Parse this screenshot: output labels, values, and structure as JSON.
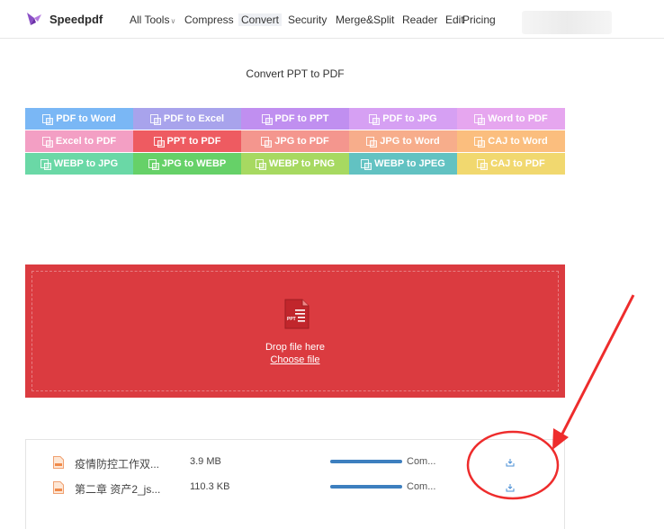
{
  "header": {
    "brand": "Speedpdf",
    "nav": [
      {
        "label": "All Tools"
      },
      {
        "label": "Compress"
      },
      {
        "label": "Convert"
      },
      {
        "label": "Security"
      },
      {
        "label": "Merge&Split"
      },
      {
        "label": "Reader"
      },
      {
        "label": "Edit"
      },
      {
        "label": "Pricing"
      }
    ],
    "active_nav": "Convert"
  },
  "page_title": "Convert PPT to PDF",
  "tools": [
    {
      "label": "PDF to Word",
      "color": "#7ab7f5"
    },
    {
      "label": "PDF to Excel",
      "color": "#a8a3ec"
    },
    {
      "label": "PDF to PPT",
      "color": "#c08ff0"
    },
    {
      "label": "PDF to JPG",
      "color": "#d6a0f3"
    },
    {
      "label": "Word to PDF",
      "color": "#e6a6ef"
    },
    {
      "label": "Excel to PDF",
      "color": "#f39fc4"
    },
    {
      "label": "PPT to PDF",
      "color": "#ee5b61"
    },
    {
      "label": "JPG to PDF",
      "color": "#f4968e"
    },
    {
      "label": "JPG to Word",
      "color": "#f7ad8b"
    },
    {
      "label": "CAJ to Word",
      "color": "#fbbe7e"
    },
    {
      "label": "WEBP to JPG",
      "color": "#6ad8a6"
    },
    {
      "label": "JPG to WEBP",
      "color": "#66d168"
    },
    {
      "label": "WEBP to PNG",
      "color": "#a7d961"
    },
    {
      "label": "WEBP to JPEG",
      "color": "#62c2c2"
    },
    {
      "label": "CAJ to PDF",
      "color": "#f1d86f"
    }
  ],
  "dropzone": {
    "color": "#db3b40",
    "text": "Drop file here",
    "choose_label": "Choose file",
    "file_type_icon": "ppt-file-icon"
  },
  "files": [
    {
      "name": "疫情防控工作双...",
      "size": "3.9 MB",
      "progress": 1.0,
      "status": "Com..."
    },
    {
      "name": "第二章 资产2_js...",
      "size": "110.3 KB",
      "progress": 1.0,
      "status": "Com..."
    }
  ],
  "icons": {
    "logo": "butterfly-logo-icon",
    "file": "document-icon",
    "download": "download-icon"
  },
  "annotation_color": "#ee2c2c"
}
